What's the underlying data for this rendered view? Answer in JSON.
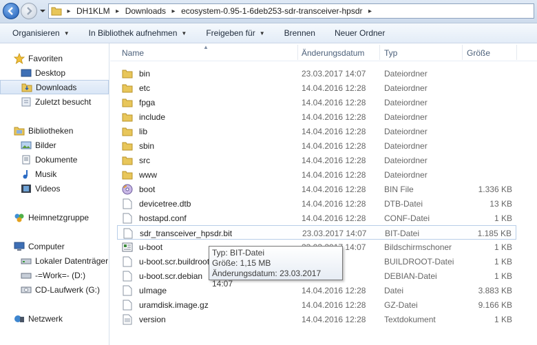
{
  "address": {
    "crumbs": [
      "DH1KLM",
      "Downloads",
      "ecosystem-0.95-1-6deb253-sdr-transceiver-hpsdr"
    ]
  },
  "toolbar": {
    "organize": "Organisieren",
    "library": "In Bibliothek aufnehmen",
    "share": "Freigeben für",
    "burn": "Brennen",
    "new_folder": "Neuer Ordner"
  },
  "nav": {
    "favorites": "Favoriten",
    "desktop": "Desktop",
    "downloads": "Downloads",
    "recent": "Zuletzt besucht",
    "libraries": "Bibliotheken",
    "pictures": "Bilder",
    "documents": "Dokumente",
    "music": "Musik",
    "videos": "Videos",
    "homegroup": "Heimnetzgruppe",
    "computer": "Computer",
    "local_disk": "Lokaler Datenträger",
    "work_drive": "-=Work=- (D:)",
    "cd_drive": "CD-Laufwerk (G:)",
    "network": "Netzwerk"
  },
  "columns": {
    "name": "Name",
    "date": "Änderungsdatum",
    "type": "Typ",
    "size": "Größe"
  },
  "files": [
    {
      "name": "bin",
      "date": "23.03.2017 14:07",
      "type": "Dateiordner",
      "size": "",
      "icon": "folder-icon"
    },
    {
      "name": "etc",
      "date": "14.04.2016 12:28",
      "type": "Dateiordner",
      "size": "",
      "icon": "folder-icon"
    },
    {
      "name": "fpga",
      "date": "14.04.2016 12:28",
      "type": "Dateiordner",
      "size": "",
      "icon": "folder-icon"
    },
    {
      "name": "include",
      "date": "14.04.2016 12:28",
      "type": "Dateiordner",
      "size": "",
      "icon": "folder-icon"
    },
    {
      "name": "lib",
      "date": "14.04.2016 12:28",
      "type": "Dateiordner",
      "size": "",
      "icon": "folder-icon"
    },
    {
      "name": "sbin",
      "date": "14.04.2016 12:28",
      "type": "Dateiordner",
      "size": "",
      "icon": "folder-icon"
    },
    {
      "name": "src",
      "date": "14.04.2016 12:28",
      "type": "Dateiordner",
      "size": "",
      "icon": "folder-icon"
    },
    {
      "name": "www",
      "date": "14.04.2016 12:28",
      "type": "Dateiordner",
      "size": "",
      "icon": "folder-icon"
    },
    {
      "name": "boot",
      "date": "14.04.2016 12:28",
      "type": "BIN File",
      "size": "1.336 KB",
      "icon": "disc-icon"
    },
    {
      "name": "devicetree.dtb",
      "date": "14.04.2016 12:28",
      "type": "DTB-Datei",
      "size": "13 KB",
      "icon": "file-icon"
    },
    {
      "name": "hostapd.conf",
      "date": "14.04.2016 12:28",
      "type": "CONF-Datei",
      "size": "1 KB",
      "icon": "file-icon"
    },
    {
      "name": "sdr_transceiver_hpsdr.bit",
      "date": "23.03.2017 14:07",
      "type": "BIT-Datei",
      "size": "1.185 KB",
      "icon": "file-icon"
    },
    {
      "name": "u-boot",
      "date": "23.03.2017 14:07",
      "type": "Bildschirmschoner",
      "size": "1 KB",
      "icon": "screensaver-icon"
    },
    {
      "name": "u-boot.scr.buildroot",
      "date": "",
      "type": "BUILDROOT-Datei",
      "size": "1 KB",
      "icon": "file-icon"
    },
    {
      "name": "u-boot.scr.debian",
      "date": "",
      "type": "DEBIAN-Datei",
      "size": "1 KB",
      "icon": "file-icon"
    },
    {
      "name": "uImage",
      "date": "14.04.2016 12:28",
      "type": "Datei",
      "size": "3.883 KB",
      "icon": "file-icon"
    },
    {
      "name": "uramdisk.image.gz",
      "date": "14.04.2016 12:28",
      "type": "GZ-Datei",
      "size": "9.166 KB",
      "icon": "file-icon"
    },
    {
      "name": "version",
      "date": "14.04.2016 12:28",
      "type": "Textdokument",
      "size": "1 KB",
      "icon": "text-file-icon"
    }
  ],
  "tooltip": {
    "type_line": "Typ: BIT-Datei",
    "size_line": "Größe: 1,15 MB",
    "date_line": "Änderungsdatum: 23.03.2017 14:07"
  },
  "colors": {
    "folder": "#e8c65a",
    "selection": "#d9e6f6",
    "accent": "#1c5bb5"
  }
}
